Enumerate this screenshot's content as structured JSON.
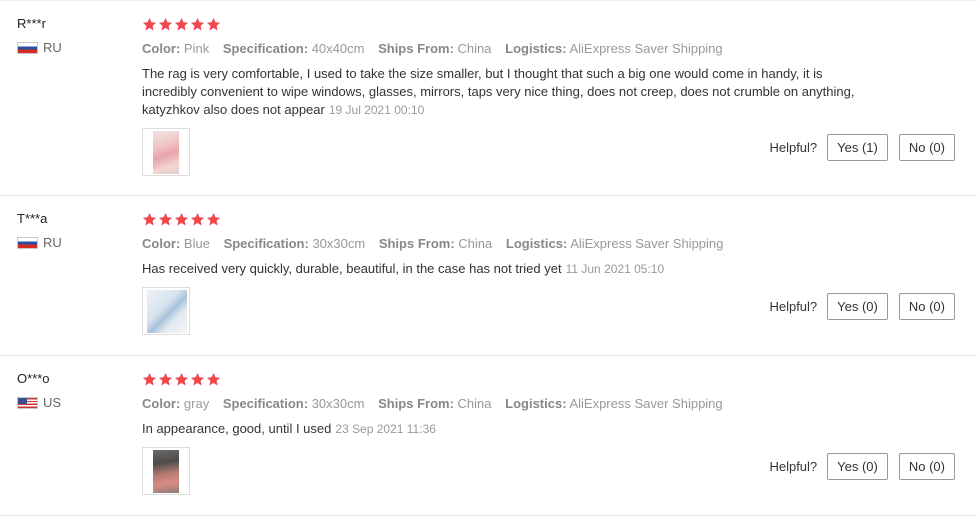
{
  "attr_labels": {
    "color": "Color:",
    "specification": "Specification:",
    "ships_from": "Ships From:",
    "logistics": "Logistics:"
  },
  "helpful_label": "Helpful?",
  "star_color": "#f0484f",
  "reviews": [
    {
      "user": "R***r",
      "country": "RU",
      "flag_icon": "russia-flag-icon",
      "stars": 5,
      "color": "Pink",
      "specification": "40x40cm",
      "ships_from": "China",
      "logistics": "AliExpress Saver Shipping",
      "text": "The rag is very comfortable, I used to take the size smaller, but I thought that such a big one would come in handy, it is incredibly convenient to wipe windows, glasses, mirrors, taps very nice thing, does not creep, does not crumble on anything, katyzhkov also does not appear",
      "date": "19 Jul 2021 00:10",
      "yes_label": "Yes (1)",
      "no_label": "No (0)"
    },
    {
      "user": "T***a",
      "country": "RU",
      "flag_icon": "russia-flag-icon",
      "stars": 5,
      "color": "Blue",
      "specification": "30x30cm",
      "ships_from": "China",
      "logistics": "AliExpress Saver Shipping",
      "text": "Has received very quickly, durable, beautiful, in the case has not tried yet",
      "date": "11 Jun 2021 05:10",
      "yes_label": "Yes (0)",
      "no_label": "No (0)"
    },
    {
      "user": "O***o",
      "country": "US",
      "flag_icon": "usa-flag-icon",
      "stars": 5,
      "color": "gray",
      "specification": "30x30cm",
      "ships_from": "China",
      "logistics": "AliExpress Saver Shipping",
      "text": "In appearance, good, until I used",
      "date": "23 Sep 2021 11:36",
      "yes_label": "Yes (0)",
      "no_label": "No (0)"
    }
  ]
}
